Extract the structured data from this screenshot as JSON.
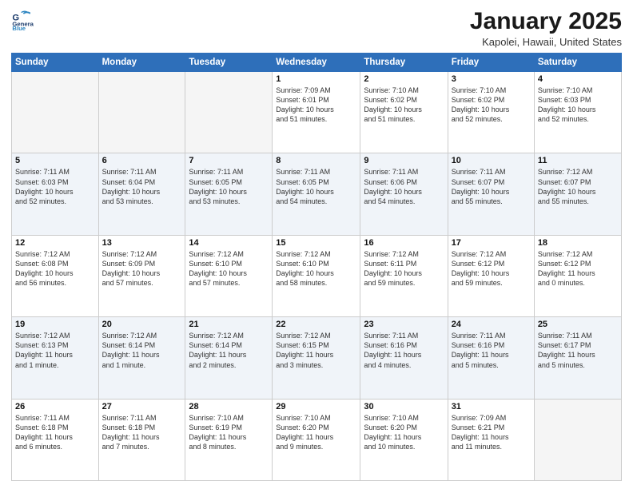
{
  "logo": {
    "line1": "General",
    "line2": "Blue"
  },
  "title": "January 2025",
  "subtitle": "Kapolei, Hawaii, United States",
  "days_of_week": [
    "Sunday",
    "Monday",
    "Tuesday",
    "Wednesday",
    "Thursday",
    "Friday",
    "Saturday"
  ],
  "weeks": [
    [
      {
        "day": "",
        "info": ""
      },
      {
        "day": "",
        "info": ""
      },
      {
        "day": "",
        "info": ""
      },
      {
        "day": "1",
        "info": "Sunrise: 7:09 AM\nSunset: 6:01 PM\nDaylight: 10 hours\nand 51 minutes."
      },
      {
        "day": "2",
        "info": "Sunrise: 7:10 AM\nSunset: 6:02 PM\nDaylight: 10 hours\nand 51 minutes."
      },
      {
        "day": "3",
        "info": "Sunrise: 7:10 AM\nSunset: 6:02 PM\nDaylight: 10 hours\nand 52 minutes."
      },
      {
        "day": "4",
        "info": "Sunrise: 7:10 AM\nSunset: 6:03 PM\nDaylight: 10 hours\nand 52 minutes."
      }
    ],
    [
      {
        "day": "5",
        "info": "Sunrise: 7:11 AM\nSunset: 6:03 PM\nDaylight: 10 hours\nand 52 minutes."
      },
      {
        "day": "6",
        "info": "Sunrise: 7:11 AM\nSunset: 6:04 PM\nDaylight: 10 hours\nand 53 minutes."
      },
      {
        "day": "7",
        "info": "Sunrise: 7:11 AM\nSunset: 6:05 PM\nDaylight: 10 hours\nand 53 minutes."
      },
      {
        "day": "8",
        "info": "Sunrise: 7:11 AM\nSunset: 6:05 PM\nDaylight: 10 hours\nand 54 minutes."
      },
      {
        "day": "9",
        "info": "Sunrise: 7:11 AM\nSunset: 6:06 PM\nDaylight: 10 hours\nand 54 minutes."
      },
      {
        "day": "10",
        "info": "Sunrise: 7:11 AM\nSunset: 6:07 PM\nDaylight: 10 hours\nand 55 minutes."
      },
      {
        "day": "11",
        "info": "Sunrise: 7:12 AM\nSunset: 6:07 PM\nDaylight: 10 hours\nand 55 minutes."
      }
    ],
    [
      {
        "day": "12",
        "info": "Sunrise: 7:12 AM\nSunset: 6:08 PM\nDaylight: 10 hours\nand 56 minutes."
      },
      {
        "day": "13",
        "info": "Sunrise: 7:12 AM\nSunset: 6:09 PM\nDaylight: 10 hours\nand 57 minutes."
      },
      {
        "day": "14",
        "info": "Sunrise: 7:12 AM\nSunset: 6:10 PM\nDaylight: 10 hours\nand 57 minutes."
      },
      {
        "day": "15",
        "info": "Sunrise: 7:12 AM\nSunset: 6:10 PM\nDaylight: 10 hours\nand 58 minutes."
      },
      {
        "day": "16",
        "info": "Sunrise: 7:12 AM\nSunset: 6:11 PM\nDaylight: 10 hours\nand 59 minutes."
      },
      {
        "day": "17",
        "info": "Sunrise: 7:12 AM\nSunset: 6:12 PM\nDaylight: 10 hours\nand 59 minutes."
      },
      {
        "day": "18",
        "info": "Sunrise: 7:12 AM\nSunset: 6:12 PM\nDaylight: 11 hours\nand 0 minutes."
      }
    ],
    [
      {
        "day": "19",
        "info": "Sunrise: 7:12 AM\nSunset: 6:13 PM\nDaylight: 11 hours\nand 1 minute."
      },
      {
        "day": "20",
        "info": "Sunrise: 7:12 AM\nSunset: 6:14 PM\nDaylight: 11 hours\nand 1 minute."
      },
      {
        "day": "21",
        "info": "Sunrise: 7:12 AM\nSunset: 6:14 PM\nDaylight: 11 hours\nand 2 minutes."
      },
      {
        "day": "22",
        "info": "Sunrise: 7:12 AM\nSunset: 6:15 PM\nDaylight: 11 hours\nand 3 minutes."
      },
      {
        "day": "23",
        "info": "Sunrise: 7:11 AM\nSunset: 6:16 PM\nDaylight: 11 hours\nand 4 minutes."
      },
      {
        "day": "24",
        "info": "Sunrise: 7:11 AM\nSunset: 6:16 PM\nDaylight: 11 hours\nand 5 minutes."
      },
      {
        "day": "25",
        "info": "Sunrise: 7:11 AM\nSunset: 6:17 PM\nDaylight: 11 hours\nand 5 minutes."
      }
    ],
    [
      {
        "day": "26",
        "info": "Sunrise: 7:11 AM\nSunset: 6:18 PM\nDaylight: 11 hours\nand 6 minutes."
      },
      {
        "day": "27",
        "info": "Sunrise: 7:11 AM\nSunset: 6:18 PM\nDaylight: 11 hours\nand 7 minutes."
      },
      {
        "day": "28",
        "info": "Sunrise: 7:10 AM\nSunset: 6:19 PM\nDaylight: 11 hours\nand 8 minutes."
      },
      {
        "day": "29",
        "info": "Sunrise: 7:10 AM\nSunset: 6:20 PM\nDaylight: 11 hours\nand 9 minutes."
      },
      {
        "day": "30",
        "info": "Sunrise: 7:10 AM\nSunset: 6:20 PM\nDaylight: 11 hours\nand 10 minutes."
      },
      {
        "day": "31",
        "info": "Sunrise: 7:09 AM\nSunset: 6:21 PM\nDaylight: 11 hours\nand 11 minutes."
      },
      {
        "day": "",
        "info": ""
      }
    ]
  ]
}
